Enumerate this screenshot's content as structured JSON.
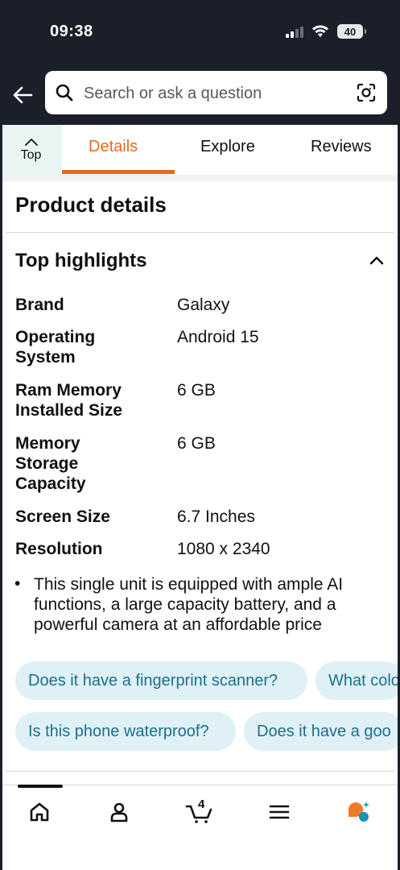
{
  "status_bar": {
    "time": "09:38",
    "battery": "40"
  },
  "search": {
    "placeholder": "Search or ask a question"
  },
  "tabs": {
    "top_label": "Top",
    "items": [
      {
        "label": "Details",
        "active": true
      },
      {
        "label": "Explore",
        "active": false
      },
      {
        "label": "Reviews",
        "active": false
      }
    ]
  },
  "content": {
    "section_title": "Product details",
    "highlights_title": "Top highlights",
    "specs": [
      {
        "label": "Brand",
        "value": "Galaxy"
      },
      {
        "label": "Operating System",
        "value": "Android 15"
      },
      {
        "label": "Ram Memory Installed Size",
        "value": "6 GB"
      },
      {
        "label": "Memory Storage Capacity",
        "value": "6 GB"
      },
      {
        "label": "Screen Size",
        "value": "6.7 Inches"
      },
      {
        "label": "Resolution",
        "value": "1080 x 2340"
      }
    ],
    "bullet": "This single unit is equipped with ample AI functions, a large capacity battery, and a powerful camera at an affordable price"
  },
  "questions": [
    "Does it have a fingerprint scanner?",
    "What colo",
    "Is this phone waterproof?",
    "Does it have a goo"
  ],
  "bottom_nav": {
    "cart_count": "4",
    "icons": [
      "home-icon",
      "account-icon",
      "cart-icon",
      "menu-icon",
      "rufus-icon"
    ]
  },
  "colors": {
    "accent": "#e7691e",
    "header_bg": "#1b1f29",
    "chip_bg": "#dff1f6",
    "chip_text": "#1b6f8a"
  }
}
